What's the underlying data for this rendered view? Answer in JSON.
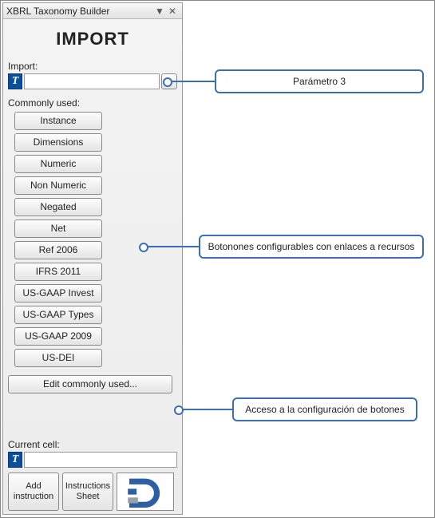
{
  "panel": {
    "title": "XBRL Taxonomy Builder",
    "dropdown_glyph": "▼",
    "close_glyph": "✕"
  },
  "heading": "IMPORT",
  "import": {
    "label": "Import:",
    "badge": "T",
    "value": ""
  },
  "commonly_used": {
    "label": "Commonly used:",
    "items": [
      "Instance",
      "Dimensions",
      "Numeric",
      "Non Numeric",
      "Negated",
      "Net",
      "Ref 2006",
      "IFRS 2011",
      "US-GAAP Invest",
      "US-GAAP Types",
      "US-GAAP 2009",
      "US-DEI"
    ],
    "edit_label": "Edit commonly used..."
  },
  "current_cell": {
    "label": "Current cell:",
    "badge": "T",
    "value": ""
  },
  "bottom": {
    "add_instruction": "Add instruction",
    "instructions_sheet": "Instructions Sheet"
  },
  "callouts": {
    "c1": "Parámetro 3",
    "c2": "Botonones configurables con enlaces a recursos",
    "c3": "Acceso a la configuración de botones"
  }
}
